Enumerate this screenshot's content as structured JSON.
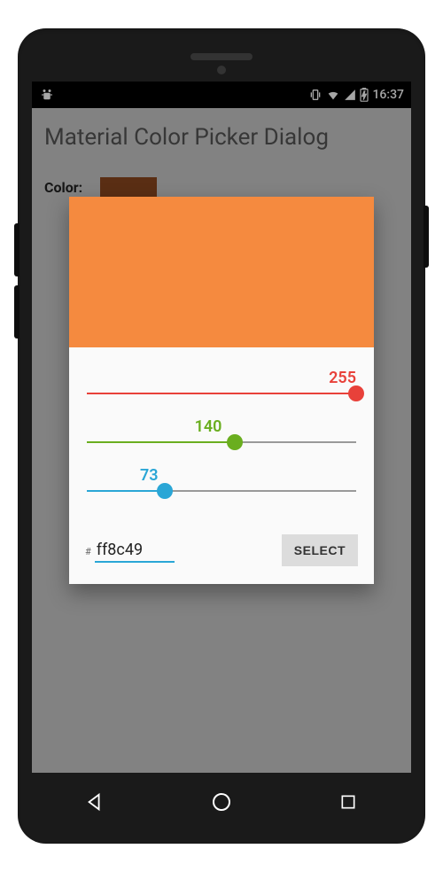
{
  "status_bar": {
    "time": "16:37"
  },
  "page": {
    "title": "Material Color Picker Dialog",
    "color_label": "Color:",
    "swatch_color": "#8B4820"
  },
  "dialog": {
    "preview_color": "#F58A3F",
    "red": {
      "value": "255",
      "max": 255,
      "pct": 100,
      "color": "#e8413a"
    },
    "green": {
      "value": "140",
      "max": 255,
      "pct": 55,
      "color": "#6aae1f"
    },
    "blue": {
      "value": "73",
      "max": 255,
      "pct": 29,
      "color": "#2aa6d6"
    },
    "hex_prefix": "#",
    "hex_value": "ff8c49",
    "select_label": "SELECT"
  }
}
